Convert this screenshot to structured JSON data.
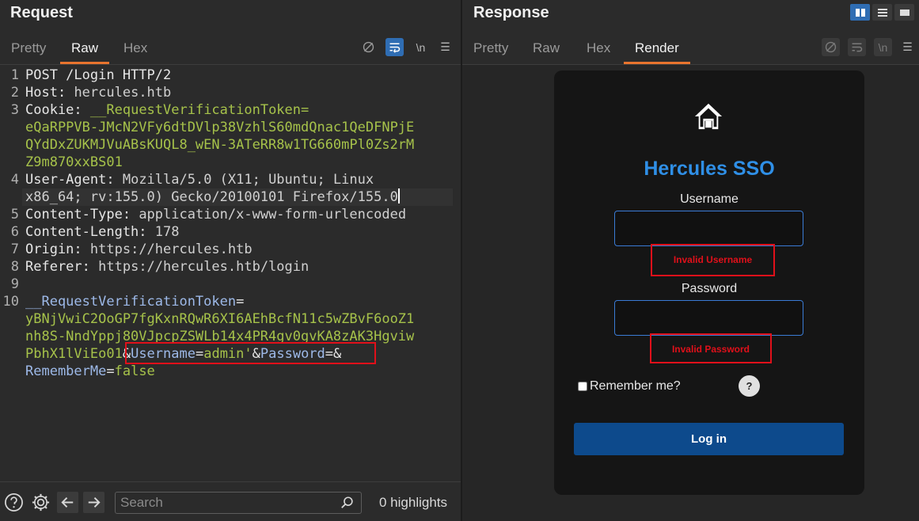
{
  "request": {
    "title": "Request",
    "tabs": [
      {
        "label": "Pretty",
        "active": false
      },
      {
        "label": "Raw",
        "active": true
      },
      {
        "label": "Hex",
        "active": false
      }
    ],
    "toolbar": {
      "newline_label": "\\n",
      "menu_label": "☰"
    },
    "lines": [
      {
        "n": "1",
        "text": "POST /Login HTTP/2"
      },
      {
        "n": "2",
        "key": "Host",
        "sep": ": ",
        "value": "hercules.htb"
      },
      {
        "n": "3",
        "key": "Cookie",
        "sep": ": ",
        "value": "__RequestVerificationToken="
      },
      {
        "n": "",
        "value": "eQaRPPVB-JMcN2VFy6dtDVlp38VzhlS60mdQnac1QeDFNPjE"
      },
      {
        "n": "",
        "value": "QYdDxZUKMJVuABsKUQL8_wEN-3ATeRR8w1TG660mPl0Zs2rM"
      },
      {
        "n": "",
        "value": "Z9m870xxBS01"
      },
      {
        "n": "4",
        "key": "User-Agent",
        "sep": ": ",
        "value": "Mozilla/5.0 (X11; Ubuntu; Linux"
      },
      {
        "n": "",
        "value": "x86_64; rv:155.0) Gecko/20100101 Firefox/155.0"
      },
      {
        "n": "5",
        "key": "Content-Type",
        "sep": ": ",
        "value": "application/x-www-form-urlencoded"
      },
      {
        "n": "6",
        "key": "Content-Length",
        "sep": ": ",
        "value": "178"
      },
      {
        "n": "7",
        "key": "Origin",
        "sep": ": ",
        "value": "https://hercules.htb"
      },
      {
        "n": "8",
        "key": "Referer",
        "sep": ": ",
        "value": "https://hercules.htb/login"
      },
      {
        "n": "9",
        "text": ""
      },
      {
        "n": "10",
        "token_key": "__RequestVerificationToken",
        "token_eq": "="
      },
      {
        "n": "",
        "token_value": "yBNjVwiC2OoGP7fgKxnRQwR6XI6AEhBcfN11c5wZBvF6ooZ1"
      },
      {
        "n": "",
        "token_value": "nh8S-NndYppj80VJpcpZSWLb14x4PR4gv0gvKA8zAK3Hgviw"
      },
      {
        "n": "",
        "token_value": "PbhX1lViEo01",
        "amp1": "&",
        "u_key": "Username",
        "eq1": "=",
        "u_val": "admin'",
        "amp2": "&",
        "p_key": "Password",
        "eq2": "=",
        "amp3": "&"
      },
      {
        "n": "",
        "r_key": "RememberMe",
        "eq3": "=",
        "r_val": "false"
      }
    ],
    "search": {
      "placeholder": "Search",
      "value": ""
    },
    "highlights": "0 highlights"
  },
  "response": {
    "title": "Response",
    "tabs": [
      {
        "label": "Pretty",
        "active": false
      },
      {
        "label": "Raw",
        "active": false
      },
      {
        "label": "Hex",
        "active": false
      },
      {
        "label": "Render",
        "active": true
      }
    ],
    "toolbar": {
      "newline_label": "\\n",
      "menu_label": "☰"
    },
    "page": {
      "title": "Hercules SSO",
      "username_label": "Username",
      "username_error": "Invalid Username",
      "password_label": "Password",
      "password_error": "Invalid Password",
      "remember_label": "Remember me?",
      "help_label": "?",
      "login_label": "Log in",
      "title_color": "#2f8fe6",
      "error_color": "#e0101a",
      "button_color": "#0d4a8c"
    }
  }
}
